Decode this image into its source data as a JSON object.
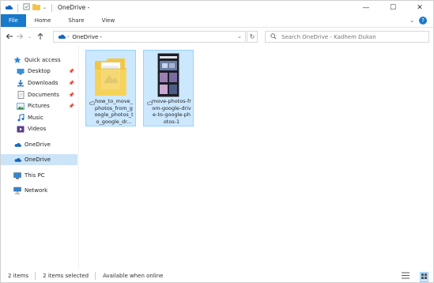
{
  "window": {
    "title": "OneDrive -",
    "controls": {
      "minimize": "—",
      "maximize": "☐",
      "close": "✕"
    }
  },
  "ribbon": {
    "tabs": [
      "File",
      "Home",
      "Share",
      "View"
    ],
    "help_icon": "?"
  },
  "address_bar": {
    "path": "OneDrive -",
    "search_placeholder": "Search OneDrive - Kadhem Dukan"
  },
  "nav_pane": {
    "items": [
      {
        "label": "Quick access",
        "icon": "star-icon"
      },
      {
        "label": "Desktop",
        "icon": "desktop-icon",
        "pinned": true
      },
      {
        "label": "Downloads",
        "icon": "downloads-icon",
        "pinned": true
      },
      {
        "label": "Documents",
        "icon": "documents-icon",
        "pinned": true
      },
      {
        "label": "Pictures",
        "icon": "pictures-icon",
        "pinned": true
      },
      {
        "label": "Music",
        "icon": "music-icon"
      },
      {
        "label": "Videos",
        "icon": "videos-icon"
      },
      {
        "label": "OneDrive",
        "icon": "cloud-icon"
      },
      {
        "label": "OneDrive",
        "icon": "cloud-icon",
        "selected": true
      },
      {
        "label": "This PC",
        "icon": "computer-icon"
      },
      {
        "label": "Network",
        "icon": "network-icon"
      }
    ]
  },
  "files": [
    {
      "name": "how_to_move_photos_from_google_photos_to_google_dr...",
      "type": "folder",
      "selected": true
    },
    {
      "name": "move-photos-from-google-drive-to-google-photos-1",
      "type": "image",
      "selected": true
    }
  ],
  "status_bar": {
    "item_count": "2 items",
    "selected_count": "2 items selected",
    "availability": "Available when online"
  },
  "colors": {
    "accent": "#1979ca",
    "selection": "#cce8ff",
    "selection_border": "#99d1ff",
    "nav_selected": "#cce4f7"
  }
}
